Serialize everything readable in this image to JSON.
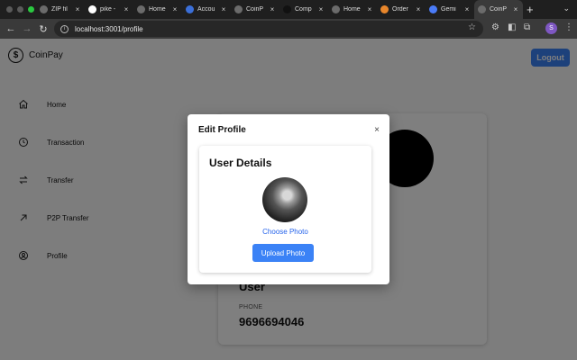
{
  "browser": {
    "tabs": [
      {
        "label": "ZIP fil",
        "icon": "globe-icon",
        "color": "#6b6b6b"
      },
      {
        "label": "pike -",
        "icon": "google-icon",
        "color": "#ffffff"
      },
      {
        "label": "Home",
        "icon": "globe-icon",
        "color": "#6b6b6b"
      },
      {
        "label": "Accou",
        "icon": "account-icon",
        "color": "#3b6fd8"
      },
      {
        "label": "CoinP",
        "icon": "globe-icon",
        "color": "#6b6b6b"
      },
      {
        "label": "Comp",
        "icon": "n-icon",
        "color": "#111111"
      },
      {
        "label": "Home",
        "icon": "globe-icon",
        "color": "#6b6b6b"
      },
      {
        "label": "Order",
        "icon": "fox-icon",
        "color": "#e8862b"
      },
      {
        "label": "Gemi",
        "icon": "gemini-icon",
        "color": "#4a7bf7"
      },
      {
        "label": "CoinP",
        "icon": "globe-icon",
        "color": "#6b6b6b",
        "active": true
      }
    ],
    "url": "localhost:3001/profile",
    "profile_initial": "S"
  },
  "app": {
    "brand": "CoinPay",
    "logout_label": "Logout",
    "nav": [
      {
        "label": "Home",
        "icon": "home-icon"
      },
      {
        "label": "Transaction",
        "icon": "clock-icon"
      },
      {
        "label": "Transfer",
        "icon": "arrows-icon"
      },
      {
        "label": "P2P Transfer",
        "icon": "arrow-up-right-icon"
      },
      {
        "label": "Profile",
        "icon": "user-circle-icon"
      }
    ],
    "profile": {
      "name": "User",
      "phone_label": "PHONE",
      "phone": "9696694046"
    }
  },
  "modal": {
    "title": "Edit Profile",
    "close": "×",
    "card_title": "User Details",
    "choose_label": "Choose Photo",
    "upload_label": "Upload Photo"
  },
  "colors": {
    "accent": "#3b82f6",
    "link": "#2563eb"
  }
}
